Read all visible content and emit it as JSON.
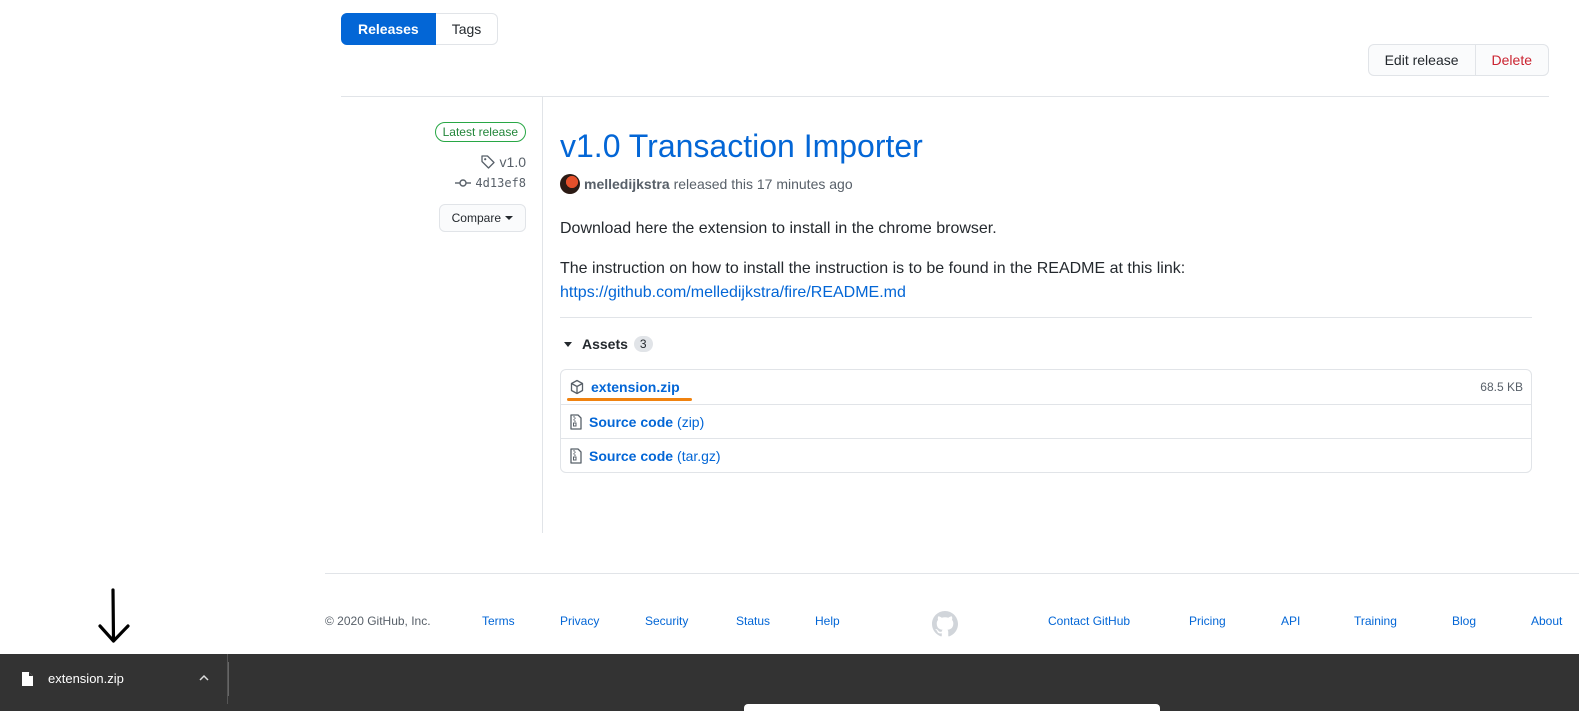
{
  "subnav": {
    "releases": "Releases",
    "tags": "Tags"
  },
  "actions": {
    "edit": "Edit release",
    "delete": "Delete"
  },
  "sidebar": {
    "latest_label": "Latest release",
    "tag": "v1.0",
    "commit": "4d13ef8",
    "compare": "Compare"
  },
  "release": {
    "title": "v1.0 Transaction Importer",
    "author": "melledijkstra",
    "released_text": "released this 17 minutes ago",
    "body_line1": "Download here the extension to install in the chrome browser.",
    "body_line2": "The instruction on how to install the instruction is to be found in the README at this link:",
    "body_link": "https://github.com/melledijkstra/fire/README.md"
  },
  "assets": {
    "heading": "Assets",
    "count": "3",
    "items": [
      {
        "name": "extension.zip",
        "suffix": "",
        "size": "68.5 KB"
      },
      {
        "name": "Source code",
        "suffix": "(zip)",
        "size": ""
      },
      {
        "name": "Source code",
        "suffix": "(tar.gz)",
        "size": ""
      }
    ]
  },
  "footer": {
    "copyright": "© 2020 GitHub, Inc.",
    "left_links": [
      "Terms",
      "Privacy",
      "Security",
      "Status",
      "Help"
    ],
    "right_links": [
      "Contact GitHub",
      "Pricing",
      "API",
      "Training",
      "Blog",
      "About"
    ]
  },
  "download_bar": {
    "filename": "extension.zip"
  },
  "colors": {
    "accent": "#0366d6",
    "danger": "#cb2431",
    "success": "#28a745",
    "highlight": "#f0820f",
    "download_bar": "#333333"
  }
}
